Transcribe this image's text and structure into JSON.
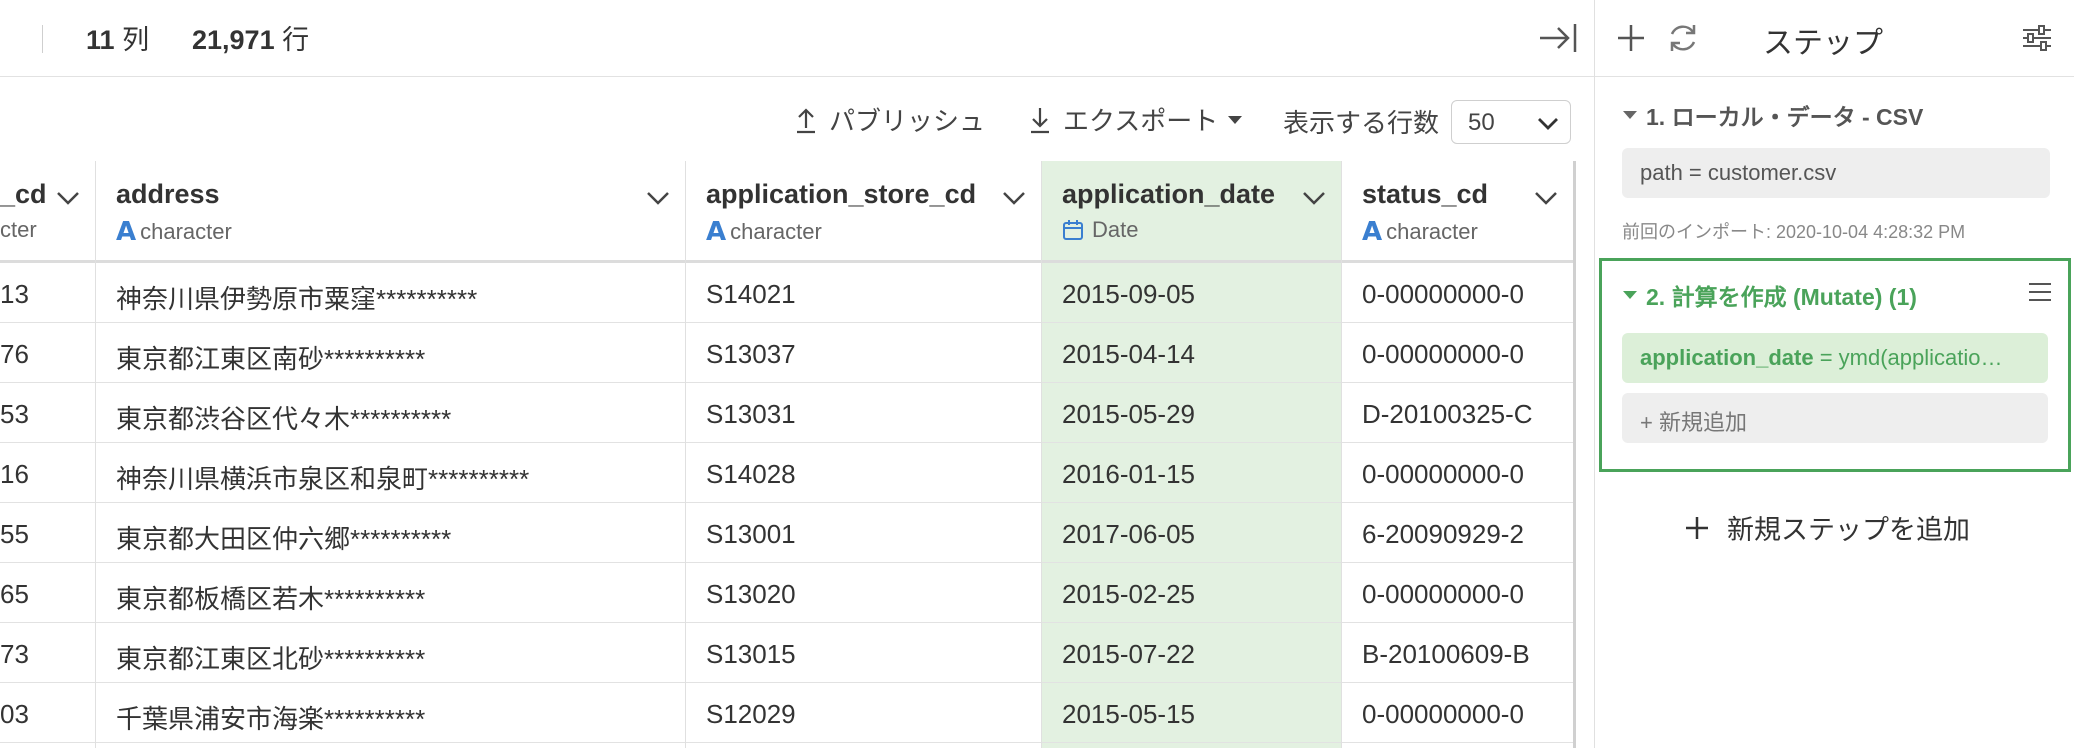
{
  "header": {
    "columns_count": "11",
    "columns_unit": "列",
    "rows_count": "21,971",
    "rows_unit": "行"
  },
  "toolbar": {
    "publish_label": "パブリッシュ",
    "export_label": "エクスポート",
    "rows_label": "表示する行数",
    "rows_value": "50"
  },
  "table": {
    "columns": [
      {
        "name": "_cd",
        "type": "cter"
      },
      {
        "name": "address",
        "type": "character"
      },
      {
        "name": "application_store_cd",
        "type": "character"
      },
      {
        "name": "application_date",
        "type": "Date"
      },
      {
        "name": "status_cd",
        "type": "character"
      }
    ],
    "rows": [
      [
        "13",
        "神奈川県伊勢原市粟窪**********",
        "S14021",
        "2015-09-05",
        "0-00000000-0"
      ],
      [
        "76",
        "東京都江東区南砂**********",
        "S13037",
        "2015-04-14",
        "0-00000000-0"
      ],
      [
        "53",
        "東京都渋谷区代々木**********",
        "S13031",
        "2015-05-29",
        "D-20100325-C"
      ],
      [
        "16",
        "神奈川県横浜市泉区和泉町**********",
        "S14028",
        "2016-01-15",
        "0-00000000-0"
      ],
      [
        "55",
        "東京都大田区仲六郷**********",
        "S13001",
        "2017-06-05",
        "6-20090929-2"
      ],
      [
        "65",
        "東京都板橋区若木**********",
        "S13020",
        "2015-02-25",
        "0-00000000-0"
      ],
      [
        "73",
        "東京都江東区北砂**********",
        "S13015",
        "2015-07-22",
        "B-20100609-B"
      ],
      [
        "03",
        "千葉県浦安市海楽**********",
        "S12029",
        "2015-05-15",
        "0-00000000-0"
      ]
    ]
  },
  "panel": {
    "title": "ステップ",
    "step1": {
      "title": "1. ローカル・データ - CSV",
      "param": "path = customer.csv",
      "note": "前回のインポート: 2020-10-04 4:28:32 PM"
    },
    "step2": {
      "title": "2. 計算を作成 (Mutate) (1)",
      "param_name": "application_date",
      "param_rest": " = ymd(applicatio…",
      "add_label": "+ 新規追加"
    },
    "add_step_label": "新規ステップを追加"
  },
  "colors": {
    "accent_green": "#4aa35a",
    "highlight_green": "#e3f1e1",
    "type_blue": "#3a7fd0"
  }
}
